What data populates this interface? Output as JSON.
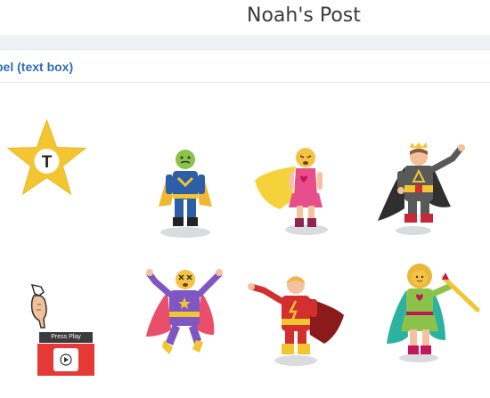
{
  "header": {
    "title": "Noah's Post"
  },
  "label_bar": {
    "text": "bel (text box)"
  },
  "star_tool": {
    "letter": "T",
    "icon": "text-star-icon",
    "color": "#f2c531"
  },
  "play_tool": {
    "label": "Press Play",
    "icon": "play-video-icon",
    "color": "#e53935"
  },
  "heroes": [
    {
      "icon": "superhero-nauseated-face-blue"
    },
    {
      "icon": "superhero-tired-face-pink"
    },
    {
      "icon": "superhero-king-gray"
    },
    {
      "icon": "superhero-dizzy-face-purple"
    },
    {
      "icon": "superhero-man-red"
    },
    {
      "icon": "superhero-woman-green"
    }
  ]
}
